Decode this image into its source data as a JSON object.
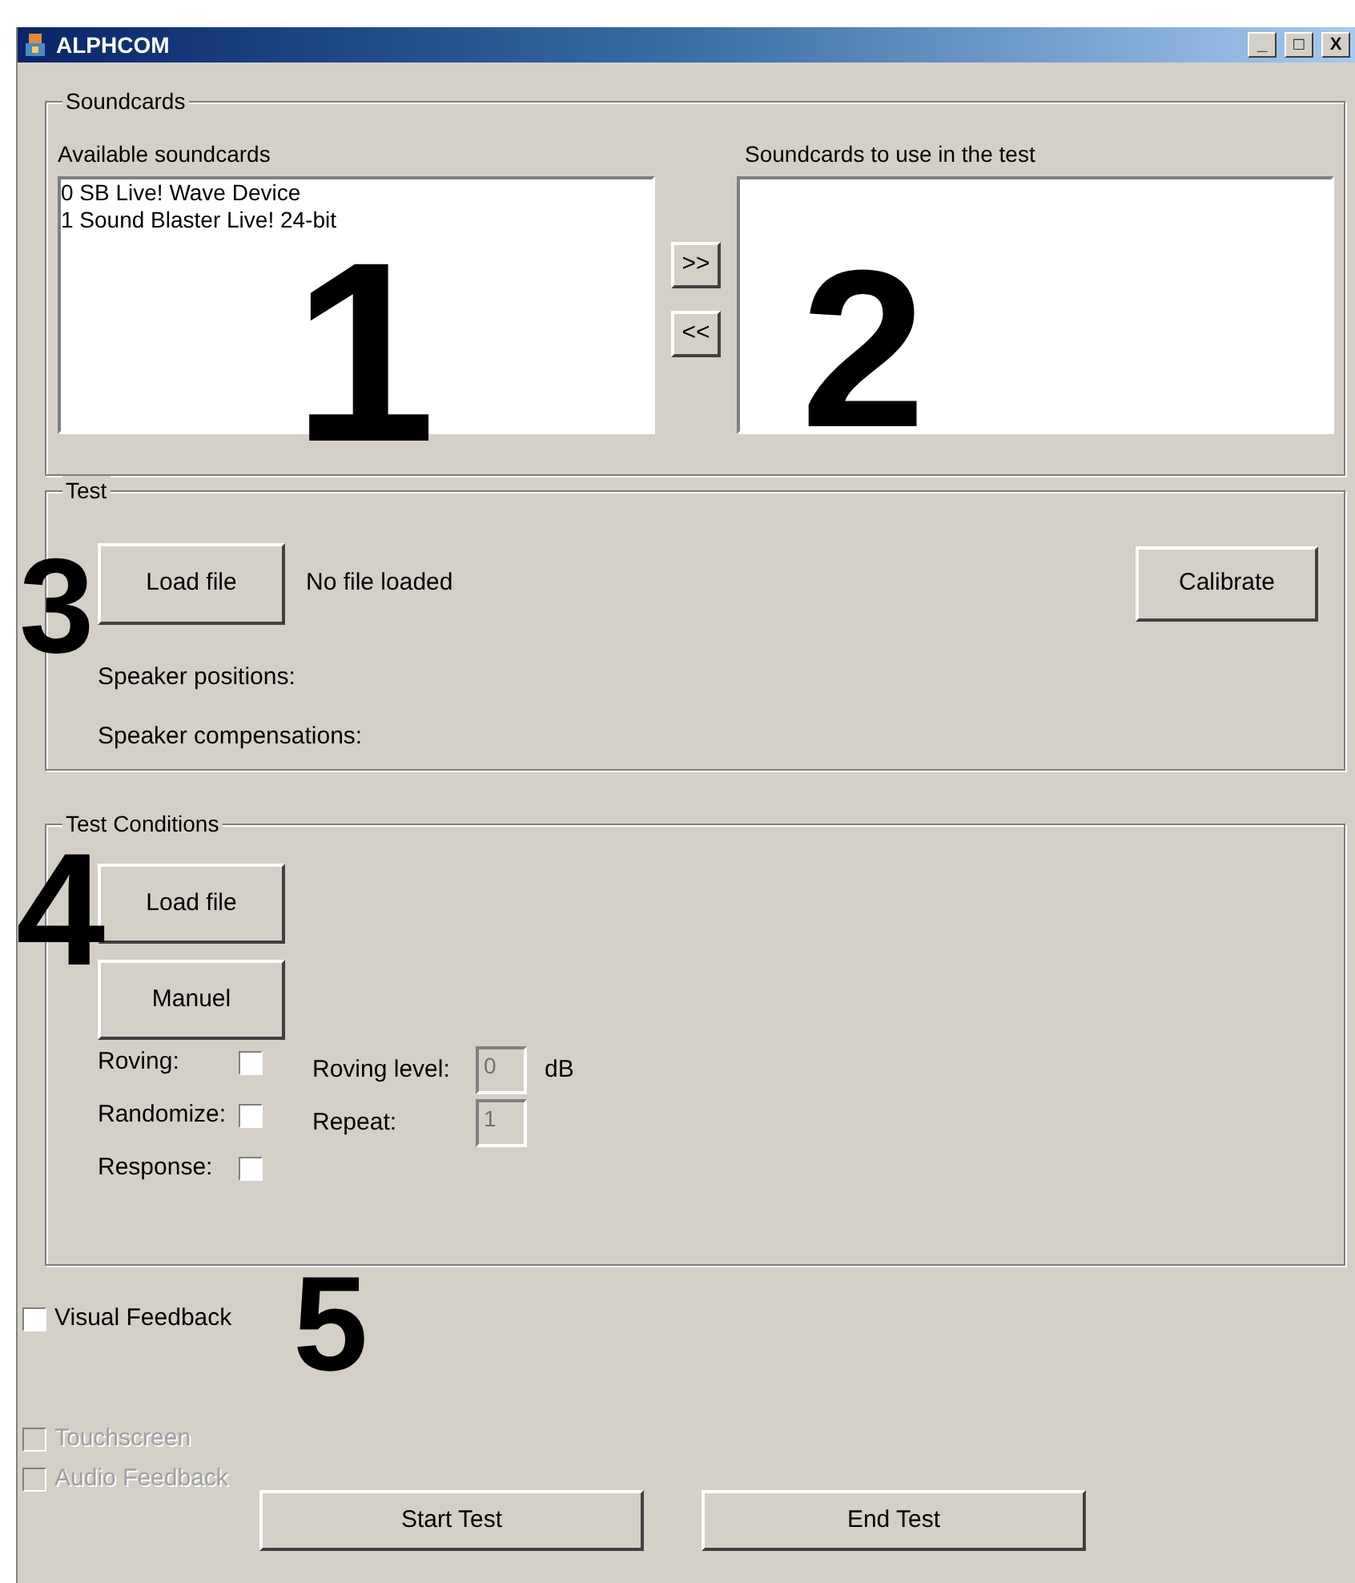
{
  "window": {
    "title": "ALPHCOM",
    "controls": [
      "_",
      "□",
      "X"
    ]
  },
  "soundcards": {
    "title": "Soundcards",
    "available_label": "Available soundcards",
    "available": [
      {
        "label": "0 SB Live! Wave Device",
        "selected": false
      },
      {
        "label": "1 Sound Blaster Live! 24-bit",
        "selected": false
      }
    ],
    "add_button": ">>",
    "remove_button": "<<",
    "used_label": "Soundcards to use in the test"
  },
  "test": {
    "title": "Test",
    "load_button": "Load file",
    "file_status": "No file loaded",
    "calibrate_button": "Calibrate",
    "speaker_positions": "Speaker positions:",
    "speaker_compensations": "Speaker compensations:"
  },
  "conditions": {
    "title": "Test Conditions",
    "load_button": "Load file",
    "manual_button": "Manuel",
    "checks": [
      {
        "label": "Roving:",
        "checked": false
      },
      {
        "label": "Randomize:",
        "checked": false
      },
      {
        "label": "Response:",
        "checked": false
      }
    ],
    "fields": [
      {
        "label": "Roving level:",
        "value": "0",
        "unit": "dB",
        "disabled": true
      },
      {
        "label": "Repeat:",
        "value": "1",
        "disabled": true
      }
    ]
  },
  "options": [
    {
      "label": "Visual Feedback",
      "checked": false,
      "disabled": false
    },
    {
      "label": "Touchscreen",
      "checked": false,
      "disabled": true
    },
    {
      "label": "Audio Feedback",
      "checked": false,
      "disabled": true
    }
  ],
  "buttons": [
    "Start Test",
    "End Test"
  ],
  "callouts": [
    "1",
    "2",
    "3",
    "4",
    "5"
  ]
}
